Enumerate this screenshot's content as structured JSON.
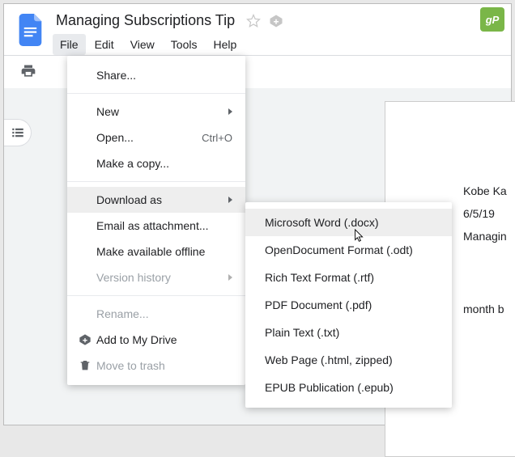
{
  "doc_title": "Managing Subscriptions Tip",
  "gp_badge": "gP",
  "menubar": {
    "file": "File",
    "edit": "Edit",
    "view": "View",
    "tools": "Tools",
    "help": "Help"
  },
  "file_menu": {
    "share": "Share...",
    "new": "New",
    "open": "Open...",
    "open_hint": "Ctrl+O",
    "make_copy": "Make a copy...",
    "download_as": "Download as",
    "email_attachment": "Email as attachment...",
    "available_offline": "Make available offline",
    "version_history": "Version history",
    "rename": "Rename...",
    "add_my_drive": "Add to My Drive",
    "move_trash": "Move to trash"
  },
  "download_submenu": {
    "word": "Microsoft Word (.docx)",
    "odt": "OpenDocument Format (.odt)",
    "rtf": "Rich Text Format (.rtf)",
    "pdf": "PDF Document (.pdf)",
    "txt": "Plain Text (.txt)",
    "html": "Web Page (.html, zipped)",
    "epub": "EPUB Publication (.epub)"
  },
  "page_content": {
    "line1": "Kobe Ka",
    "line2": "6/5/19",
    "line3": "Managin",
    "line4": "month b"
  }
}
